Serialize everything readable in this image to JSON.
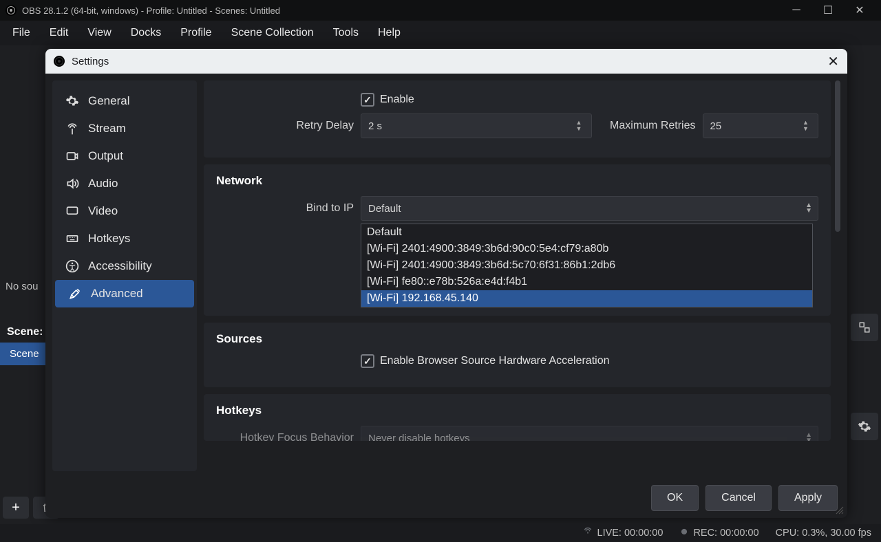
{
  "window": {
    "title": "OBS 28.1.2 (64-bit, windows) - Profile: Untitled - Scenes: Untitled"
  },
  "menu": {
    "file": "File",
    "edit": "Edit",
    "view": "View",
    "docks": "Docks",
    "profile": "Profile",
    "scene_collection": "Scene Collection",
    "tools": "Tools",
    "help": "Help"
  },
  "bg": {
    "no_sources": "No sou",
    "scenes": "Scene:",
    "scene": "Scene"
  },
  "dialog": {
    "title": "Settings",
    "sidebar": [
      "General",
      "Stream",
      "Output",
      "Audio",
      "Video",
      "Hotkeys",
      "Accessibility",
      "Advanced"
    ],
    "reconnect": {
      "enable_label": "Enable",
      "retry_delay_label": "Retry Delay",
      "retry_delay_value": "2 s",
      "max_retries_label": "Maximum Retries",
      "max_retries_value": "25"
    },
    "network": {
      "title": "Network",
      "bind_label": "Bind to IP",
      "bind_value": "Default",
      "options": [
        "Default",
        "[Wi-Fi] 2401:4900:3849:3b6d:90c0:5e4:cf79:a80b",
        "[Wi-Fi] 2401:4900:3849:3b6d:5c70:6f31:86b1:2db6",
        "[Wi-Fi] fe80::e78b:526a:e4d:f4b1",
        "[Wi-Fi] 192.168.45.140"
      ]
    },
    "sources": {
      "title": "Sources",
      "hwaccel_label": "Enable Browser Source Hardware Acceleration"
    },
    "hotkeys": {
      "title": "Hotkeys",
      "focus_label": "Hotkey Focus Behavior",
      "focus_value": "Never disable hotkeys"
    },
    "buttons": {
      "ok": "OK",
      "cancel": "Cancel",
      "apply": "Apply"
    }
  },
  "status": {
    "live": "LIVE: 00:00:00",
    "rec": "REC: 00:00:00",
    "cpu": "CPU: 0.3%, 30.00 fps"
  }
}
